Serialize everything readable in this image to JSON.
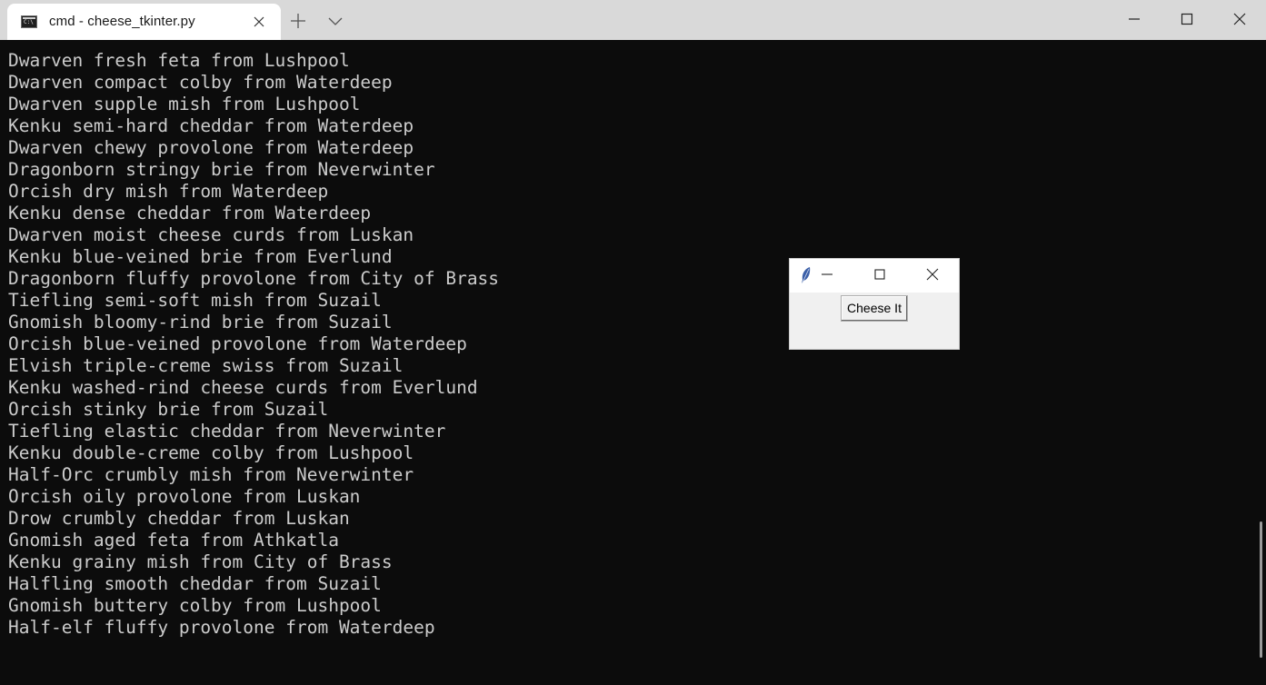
{
  "window": {
    "tab_title": "cmd - cheese_tkinter.py",
    "icons": {
      "tab": "command-prompt-icon",
      "tab_close": "close-icon",
      "new_tab": "plus-icon",
      "dropdown": "chevron-down-icon",
      "minimize": "minimize-icon",
      "maximize": "maximize-icon",
      "close": "close-icon"
    }
  },
  "terminal": {
    "lines": [
      "Dwarven fresh feta from Lushpool",
      "Dwarven compact colby from Waterdeep",
      "Dwarven supple mish from Lushpool",
      "Kenku semi-hard cheddar from Waterdeep",
      "Dwarven chewy provolone from Waterdeep",
      "Dragonborn stringy brie from Neverwinter",
      "Orcish dry mish from Waterdeep",
      "Kenku dense cheddar from Waterdeep",
      "Dwarven moist cheese curds from Luskan",
      "Kenku blue-veined brie from Everlund",
      "Dragonborn fluffy provolone from City of Brass",
      "Tiefling semi-soft mish from Suzail",
      "Gnomish bloomy-rind brie from Suzail",
      "Orcish blue-veined provolone from Waterdeep",
      "Elvish triple-creme swiss from Suzail",
      "Kenku washed-rind cheese curds from Everlund",
      "Orcish stinky brie from Suzail",
      "Tiefling elastic cheddar from Neverwinter",
      "Kenku double-creme colby from Lushpool",
      "Half-Orc crumbly mish from Neverwinter",
      "Orcish oily provolone from Luskan",
      "Drow crumbly cheddar from Luskan",
      "Gnomish aged feta from Athkatla",
      "Kenku grainy mish from City of Brass",
      "Halfling smooth cheddar from Suzail",
      "Gnomish buttery colby from Lushpool",
      "Half-elf fluffy provolone from Waterdeep"
    ],
    "colors": {
      "background": "#0c0c0c",
      "text": "#cccccc"
    }
  },
  "tk_window": {
    "button_label": "Cheese It",
    "icons": {
      "app": "feather-icon",
      "minimize": "minimize-icon",
      "maximize": "maximize-icon",
      "close": "close-icon"
    }
  }
}
